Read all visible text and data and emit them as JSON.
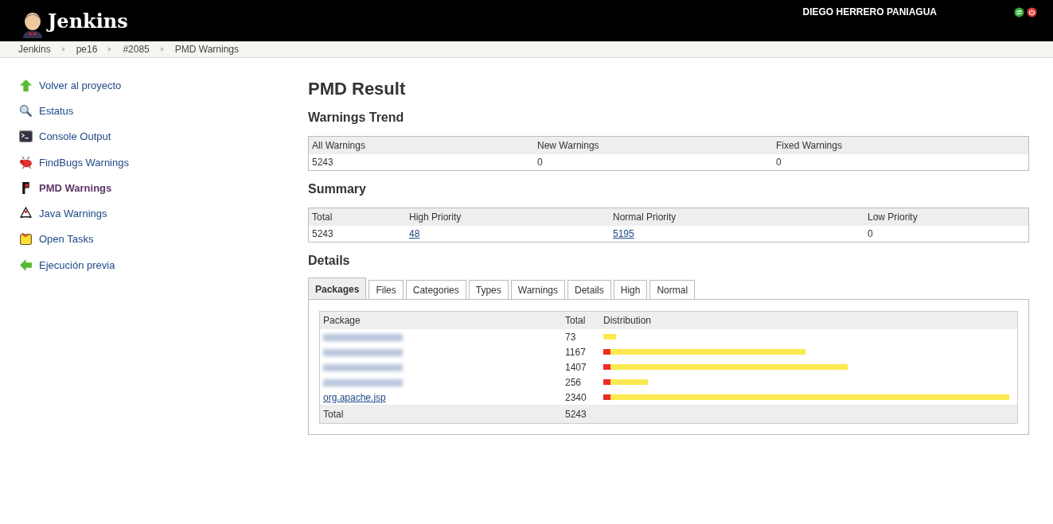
{
  "header": {
    "logo": "Jenkins",
    "user": "DIEGO HERRERO PANIAGUA"
  },
  "breadcrumbs": [
    "Jenkins",
    "pe16",
    "#2085",
    "PMD Warnings"
  ],
  "sidebar": {
    "items": [
      {
        "label": "Volver al proyecto",
        "selected": false
      },
      {
        "label": "Estatus",
        "selected": false
      },
      {
        "label": "Console Output",
        "selected": false
      },
      {
        "label": "FindBugs Warnings",
        "selected": false
      },
      {
        "label": "PMD Warnings",
        "selected": true
      },
      {
        "label": "Java Warnings",
        "selected": false
      },
      {
        "label": "Open Tasks",
        "selected": false
      },
      {
        "label": "Ejecución previa",
        "selected": false
      }
    ]
  },
  "title": "PMD Result",
  "trend": {
    "heading": "Warnings Trend",
    "columns": [
      "All Warnings",
      "New Warnings",
      "Fixed Warnings"
    ],
    "values": [
      {
        "text": "5243",
        "kind": "text"
      },
      {
        "text": "0",
        "kind": "text"
      },
      {
        "text": "0",
        "kind": "text"
      }
    ]
  },
  "summary": {
    "heading": "Summary",
    "columns": [
      "Total",
      "High Priority",
      "Normal Priority",
      "Low Priority"
    ],
    "values": [
      {
        "text": "5243",
        "kind": "text"
      },
      {
        "text": "48",
        "kind": "link"
      },
      {
        "text": "5195",
        "kind": "link"
      },
      {
        "text": "0",
        "kind": "text"
      }
    ]
  },
  "details": {
    "heading": "Details",
    "tabs": [
      {
        "label": "Packages",
        "selected": true
      },
      {
        "label": "Files",
        "selected": false
      },
      {
        "label": "Categories",
        "selected": false
      },
      {
        "label": "Types",
        "selected": false
      },
      {
        "label": "Warnings",
        "selected": false
      },
      {
        "label": "Details",
        "selected": false
      },
      {
        "label": "High",
        "selected": false
      },
      {
        "label": "Normal",
        "selected": false
      }
    ],
    "table": {
      "columns": [
        "Package",
        "Total",
        "Distribution"
      ],
      "rows": [
        {
          "redacted": true,
          "total": "73",
          "high": false
        },
        {
          "redacted": true,
          "total": "1167",
          "high": true
        },
        {
          "redacted": true,
          "total": "1407",
          "high": true
        },
        {
          "redacted": true,
          "total": "256",
          "high": true
        },
        {
          "redacted": false,
          "package": "org.apache.jsp",
          "total": "2340",
          "high": true
        }
      ],
      "footer": {
        "label": "Total",
        "total": "5243"
      }
    }
  }
}
